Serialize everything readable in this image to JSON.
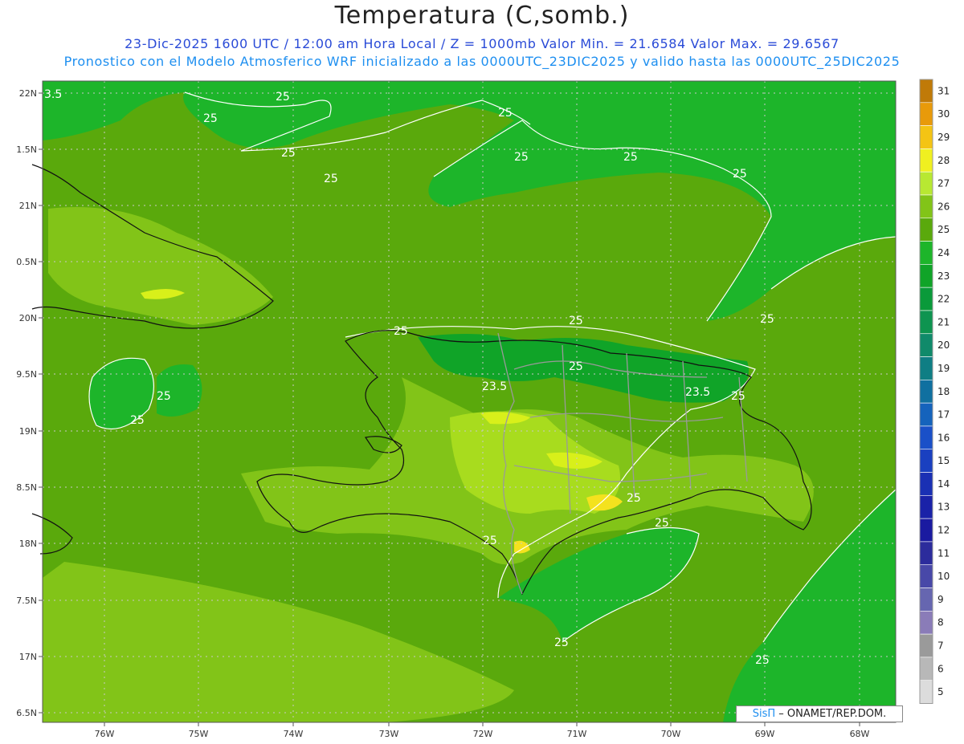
{
  "header": {
    "title": "Temperatura (C,somb.)",
    "line1": "23-Dic-2025 1600 UTC / 12:00 am Hora Local / Z = 1000mb  Valor Min. = 21.6584  Valor Max. = 29.6567",
    "line2": "Pronostico con el Modelo Atmosferico WRF inicializado a las 0000UTC_23DIC2025 y valido hasta las  0000UTC_25DIC2025"
  },
  "map": {
    "lon_ticks": [
      "76W",
      "75W",
      "74W",
      "73W",
      "72W",
      "71W",
      "70W",
      "69W",
      "68W"
    ],
    "lat_ticks": [
      "22N",
      "1.5N",
      "21N",
      "0.5N",
      "20N",
      "9.5N",
      "19N",
      "8.5N",
      "18N",
      "7.5N",
      "17N",
      "6.5N"
    ],
    "contour_labels": [
      {
        "text": "3.5"
      },
      {
        "text": "25"
      },
      {
        "text": "25"
      },
      {
        "text": "25"
      },
      {
        "text": "25"
      },
      {
        "text": "25"
      },
      {
        "text": "25"
      },
      {
        "text": "25"
      },
      {
        "text": "25"
      },
      {
        "text": "25"
      },
      {
        "text": "25"
      },
      {
        "text": "25"
      },
      {
        "text": "23.5"
      },
      {
        "text": "23.5"
      },
      {
        "text": "25"
      },
      {
        "text": "25"
      },
      {
        "text": "25"
      },
      {
        "text": "25"
      },
      {
        "text": "25"
      },
      {
        "text": "25"
      },
      {
        "text": "25"
      },
      {
        "text": "25"
      },
      {
        "text": "25"
      }
    ],
    "colors": {
      "t23": "#10a428",
      "t24": "#1db52a",
      "t25": "#5aa90c",
      "t26": "#82c418",
      "t27": "#a8dc1e",
      "t28": "#d8f01a",
      "t29": "#f4e21e"
    }
  },
  "colorbar": {
    "levels": [
      "31",
      "30",
      "29",
      "28",
      "27",
      "26",
      "25",
      "24",
      "23",
      "22",
      "21",
      "20",
      "19",
      "18",
      "17",
      "16",
      "15",
      "14",
      "13",
      "12",
      "11",
      "10",
      "9",
      "8",
      "7",
      "6",
      "5"
    ],
    "colors": [
      "#c07a08",
      "#e89a0a",
      "#f4c414",
      "#f0f020",
      "#b8e832",
      "#82c418",
      "#5aa90c",
      "#1db52a",
      "#10a428",
      "#0a9a3a",
      "#0e9450",
      "#108a6a",
      "#0f7e84",
      "#1070a0",
      "#1563bc",
      "#1a50c8",
      "#1a40c0",
      "#1a30b4",
      "#1a22a8",
      "#1a1aa0",
      "#2c2c9c",
      "#4848a8",
      "#6666b0",
      "#8a7cb8",
      "#9a9a9a",
      "#b8b8b8",
      "#dcdcdc"
    ]
  },
  "credit": {
    "sis": "SisΠ",
    "text": "– ONAMET/REP.DOM."
  }
}
